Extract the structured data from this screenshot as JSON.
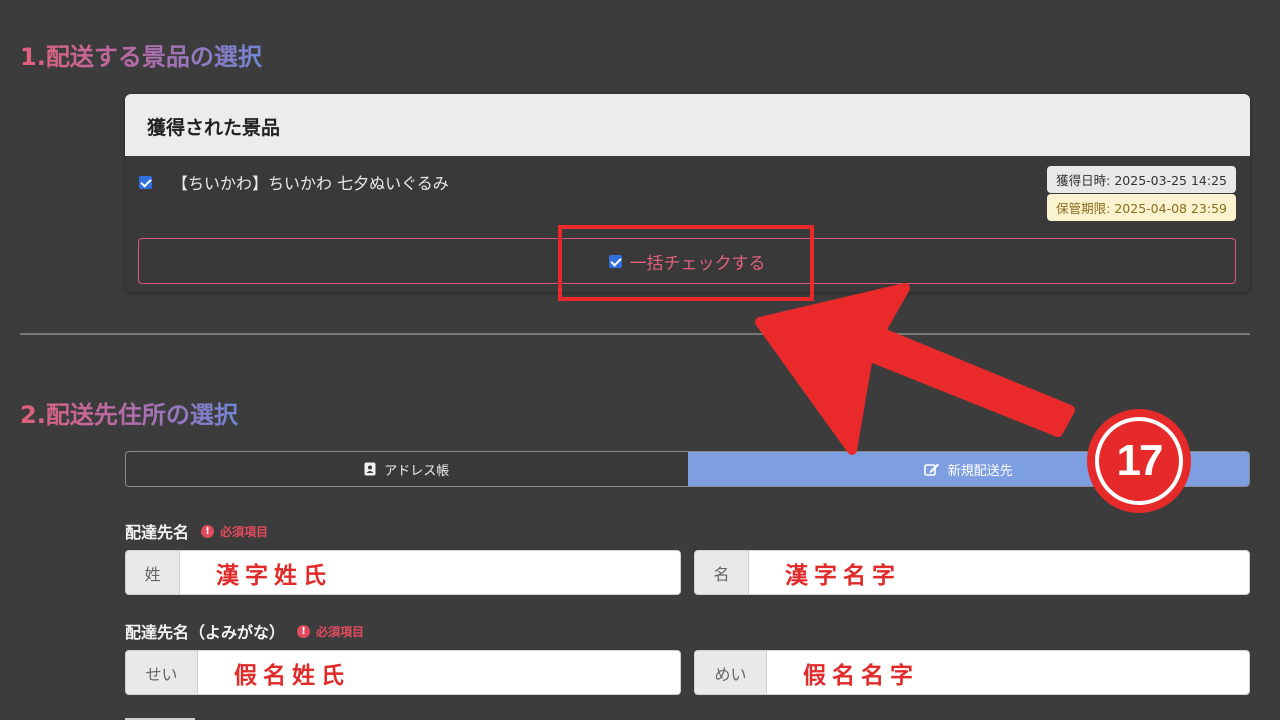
{
  "section1": {
    "title": "1.配送する景品の選択",
    "card_header": "獲得された景品",
    "prize": {
      "name": "【ちいかわ】ちいかわ 七夕ぬいぐるみ",
      "checked": true,
      "acquired_label": "獲得日時: 2025-03-25 14:25",
      "expiry_label": "保管期限: 2025-04-08 23:59"
    },
    "bulk_check": {
      "label": "一括チェックする",
      "checked": true
    }
  },
  "section2": {
    "title": "2.配送先住所の選択",
    "tabs": [
      {
        "label": "アドレス帳",
        "icon": "address-book-icon",
        "active": false
      },
      {
        "label": "新規配送先",
        "icon": "edit-icon",
        "active": true
      }
    ],
    "recipient_name": {
      "label": "配達先名",
      "required": "必須項目",
      "sei": {
        "addon": "姓",
        "value": "漢字姓氏"
      },
      "mei": {
        "addon": "名",
        "value": "漢字名字"
      }
    },
    "recipient_kana": {
      "label": "配達先名（よみがな）",
      "required": "必須項目",
      "sei": {
        "addon": "せい",
        "value": "假名姓氏"
      },
      "mei": {
        "addon": "めい",
        "value": "假名名字"
      }
    }
  },
  "annotation": {
    "step": "17"
  },
  "colors": {
    "background": "#3d3c3c",
    "accent_pink": "#e2607e",
    "accent_blue": "#7d9ee0",
    "annotation_red": "#e62a2a",
    "required_red": "#e24a5e"
  }
}
